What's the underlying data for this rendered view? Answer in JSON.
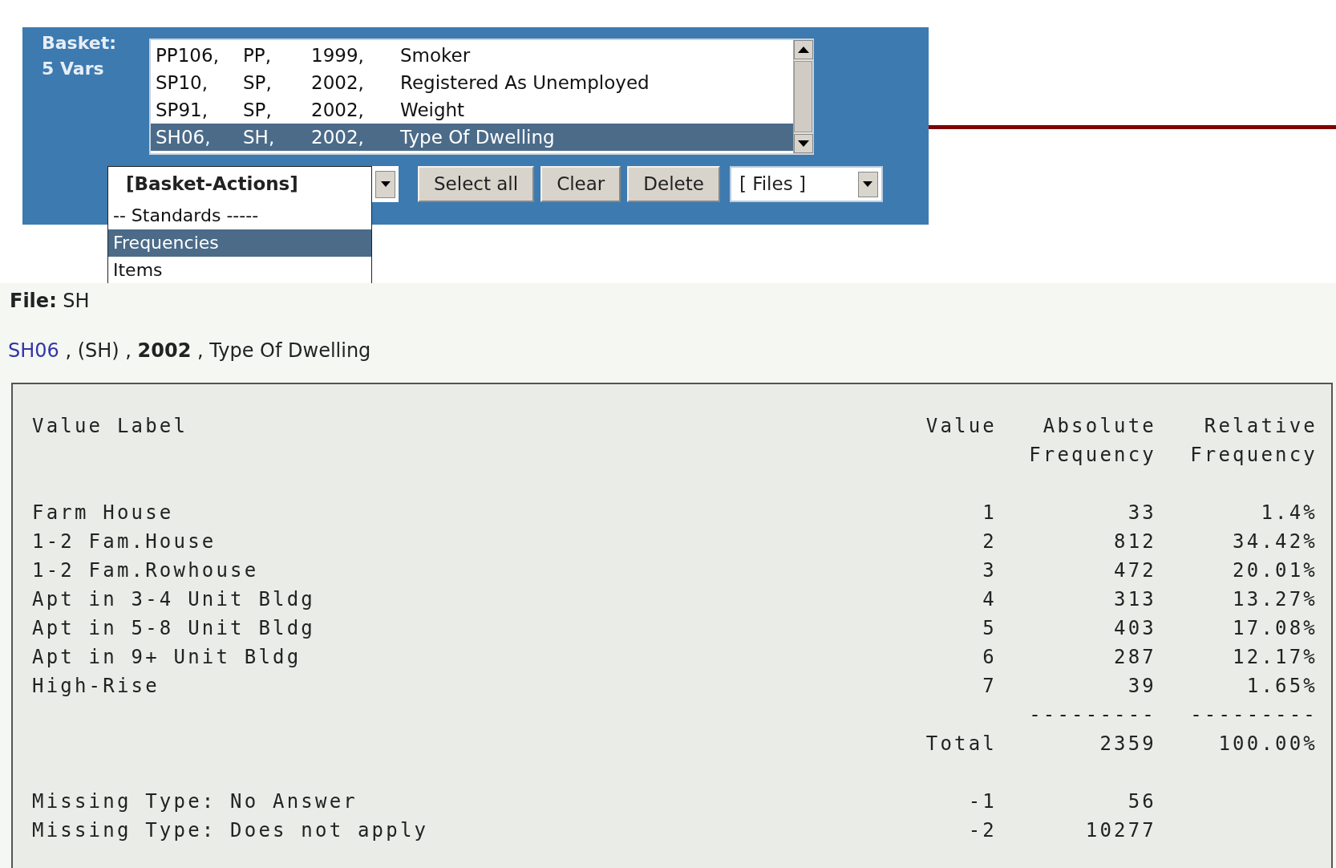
{
  "basket": {
    "label": "Basket:",
    "count": "5 Vars",
    "variables": [
      {
        "id": "PP106,",
        "file": "PP,",
        "year": "1999,",
        "label": "Smoker",
        "selected": false
      },
      {
        "id": "SP10,",
        "file": "SP,",
        "year": "2002,",
        "label": "Registered As Unemployed",
        "selected": false
      },
      {
        "id": "SP91,",
        "file": "SP,",
        "year": "2002,",
        "label": "Weight",
        "selected": false
      },
      {
        "id": "SH06,",
        "file": "SH,",
        "year": "2002,",
        "label": "Type Of Dwelling",
        "selected": true
      }
    ]
  },
  "actions_dropdown": {
    "value": "[Basket-Actions]",
    "options": [
      {
        "label": "-- Standards -----",
        "selected": false
      },
      {
        "label": "Frequencies",
        "selected": true
      },
      {
        "label": "Items",
        "selected": false
      }
    ]
  },
  "buttons": [
    "Select all",
    "Clear",
    "Delete"
  ],
  "files_select": {
    "value": "[ Files ]"
  },
  "file_line": {
    "label": "File:",
    "value": "SH"
  },
  "variable_line": {
    "link": "SH06",
    "rest": " , (SH) , **2002** , Type Of Dwelling"
  },
  "table": {
    "columns": [
      "Value Label",
      "Value",
      "Absolute Frequency",
      "Relative Frequency"
    ],
    "rows": [
      {
        "kind": "category",
        "label": "Farm House",
        "value": "1",
        "absolute": "33",
        "relative": "1.4%"
      },
      {
        "kind": "category",
        "label": "1-2 Fam.House",
        "value": "2",
        "absolute": "812",
        "relative": "34.42%"
      },
      {
        "kind": "category",
        "label": "1-2 Fam.Rowhouse",
        "value": "3",
        "absolute": "472",
        "relative": "20.01%"
      },
      {
        "kind": "category",
        "label": "Apt in 3-4 Unit Bldg",
        "value": "4",
        "absolute": "313",
        "relative": "13.27%"
      },
      {
        "kind": "category",
        "label": "Apt in 5-8 Unit Bldg",
        "value": "5",
        "absolute": "403",
        "relative": "17.08%"
      },
      {
        "kind": "category",
        "label": "Apt in 9+ Unit Bldg",
        "value": "6",
        "absolute": "287",
        "relative": "12.17%"
      },
      {
        "kind": "category",
        "label": "High-Rise",
        "value": "7",
        "absolute": "39",
        "relative": "1.65%"
      },
      {
        "kind": "rule",
        "absolute": "---------",
        "relative": "---------"
      },
      {
        "kind": "total",
        "value": "Total",
        "absolute": "2359",
        "relative": "100.00%"
      },
      {
        "kind": "missing",
        "label": "Missing Type: No Answer",
        "value": "-1",
        "absolute": "56"
      },
      {
        "kind": "missing",
        "label": "Missing Type: Does not apply",
        "value": "-2",
        "absolute": "10277"
      }
    ]
  }
}
